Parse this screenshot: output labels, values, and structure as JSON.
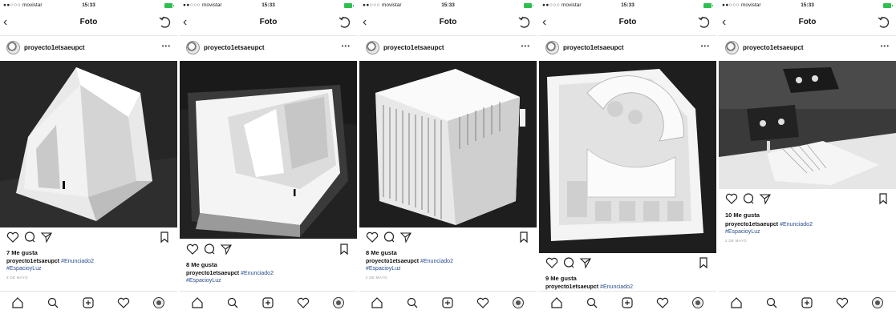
{
  "status_bar": {
    "carrier": "movistar",
    "time": "15:33"
  },
  "navbar": {
    "title": "Foto"
  },
  "post_header": {
    "username": "proyecto1etsaeupct"
  },
  "posts": [
    {
      "likes": "7 Me gusta",
      "username": "proyecto1etsaeupct",
      "tag1": "#Enunciado2",
      "tag2": "#EspacioyLuz",
      "date": "2 DE MAYO"
    },
    {
      "likes": "8 Me gusta",
      "username": "proyecto1etsaeupct",
      "tag1": "#Enunciado2",
      "tag2": "#EspacioyLuz",
      "date": ""
    },
    {
      "likes": "8 Me gusta",
      "username": "proyecto1etsaeupct",
      "tag1": "#Enunciado2",
      "tag2": "#EspacioyLuz",
      "date": "2 DE MAYO"
    },
    {
      "likes": "9 Me gusta",
      "username": "proyecto1etsaeupct",
      "tag1": "#Enunciado2",
      "tag2": "",
      "date": ""
    },
    {
      "likes": "10 Me gusta",
      "username": "proyecto1etsaeupct",
      "tag1": "#Enunciado2",
      "tag2": "#EspacioyLuz",
      "date": "2 DE MAYO"
    }
  ],
  "icons": {
    "back": "chevron-left-icon",
    "refresh": "refresh-icon",
    "more": "more-icon",
    "like": "heart-icon",
    "comment": "comment-icon",
    "share": "send-icon",
    "save": "bookmark-icon",
    "tabs": [
      "home-icon",
      "search-icon",
      "add-icon",
      "activity-icon",
      "profile-icon"
    ]
  },
  "colors": {
    "hashtag": "#2a4d8f",
    "battery": "#2fbf50"
  }
}
